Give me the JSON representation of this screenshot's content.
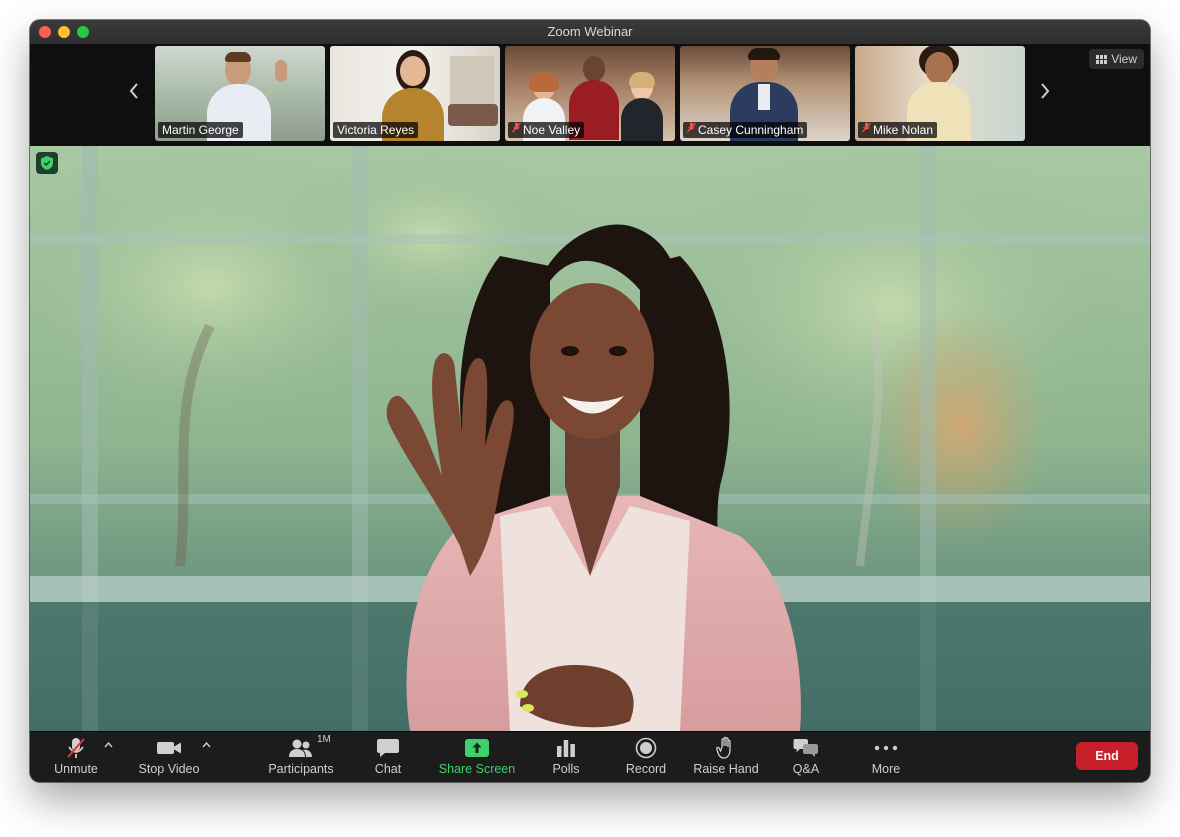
{
  "window": {
    "title": "Zoom Webinar"
  },
  "gallery": {
    "view_label": "View",
    "tiles": [
      {
        "name": "Martin George",
        "muted": false,
        "active": false
      },
      {
        "name": "Victoria Reyes",
        "muted": false,
        "active": true
      },
      {
        "name": "Noe Valley",
        "muted": true,
        "active": false
      },
      {
        "name": "Casey Cunningham",
        "muted": true,
        "active": false
      },
      {
        "name": "Mike Nolan",
        "muted": true,
        "active": false
      }
    ]
  },
  "toolbar": {
    "unmute": "Unmute",
    "stop_video": "Stop Video",
    "participants": "Participants",
    "participants_count": "1M",
    "chat": "Chat",
    "share_screen": "Share Screen",
    "polls": "Polls",
    "record": "Record",
    "raise_hand": "Raise Hand",
    "qa": "Q&A",
    "more": "More",
    "end": "End"
  },
  "colors": {
    "share_green": "#3ed06a",
    "end_red": "#c7202a",
    "active_border": "#28c840"
  }
}
